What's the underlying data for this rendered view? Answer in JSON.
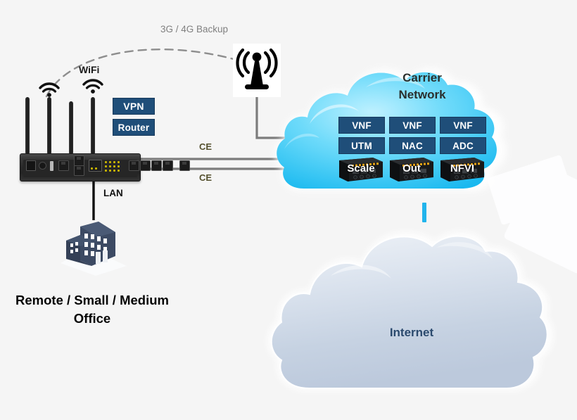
{
  "diagram": {
    "title": "Carrier Network vNF Branch Office Topology",
    "background": "#f5f5f5",
    "accent_blue": "#1f4e79",
    "cloud_cyan": "#3dc8f5",
    "internet_gray": "#ced8e6",
    "link_cyan": "#21b4ec"
  },
  "branch": {
    "office_label": "Remote / Small / Medium Office",
    "lan_label": "LAN",
    "wifi_label": "WiFi",
    "router_tags": [
      {
        "label": "VPN"
      },
      {
        "label": "Router"
      }
    ],
    "device_name": "branch-router"
  },
  "wireless": {
    "backup_label": "3G / 4G Backup",
    "tower_name": "cell-tower"
  },
  "links": {
    "ce_top_label": "CE",
    "ce_bottom_label": "CE"
  },
  "carrier_cloud": {
    "title_line1": "Carrier",
    "title_line2": "Network",
    "vnf_columns": [
      {
        "top_label": "VNF",
        "bottom_label": "UTM",
        "appliance_label": "Scale"
      },
      {
        "top_label": "VNF",
        "bottom_label": "NAC",
        "appliance_label": "Out"
      },
      {
        "top_label": "VNF",
        "bottom_label": "ADC",
        "appliance_label": "NFVI"
      }
    ]
  },
  "internet_cloud": {
    "title": "Internet"
  }
}
